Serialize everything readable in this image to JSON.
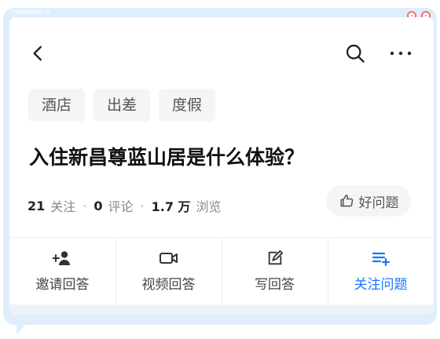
{
  "header": {
    "back_icon": "back-arrow-icon",
    "search_icon": "search-icon",
    "more_icon": "more-dots-icon"
  },
  "tags": [
    {
      "label": "酒店"
    },
    {
      "label": "出差"
    },
    {
      "label": "度假"
    }
  ],
  "question": {
    "title": "入住新昌尊蓝山居是什么体验？"
  },
  "stats": {
    "followers_num": "21",
    "followers_label": "关注",
    "comments_num": "0",
    "comments_label": "评论",
    "views_num": "1.7 万",
    "views_label": "浏览"
  },
  "good_question": {
    "label": "好问题",
    "icon": "thumbs-up-icon"
  },
  "actions": [
    {
      "label": "邀请回答",
      "icon": "invite-user-icon"
    },
    {
      "label": "视频回答",
      "icon": "video-camera-icon"
    },
    {
      "label": "写回答",
      "icon": "edit-icon"
    },
    {
      "label": "关注问题",
      "icon": "follow-list-icon"
    }
  ],
  "colors": {
    "accent": "#1677ff",
    "frame": "#dfeefc",
    "corner_dot": "#ff6b6b"
  }
}
